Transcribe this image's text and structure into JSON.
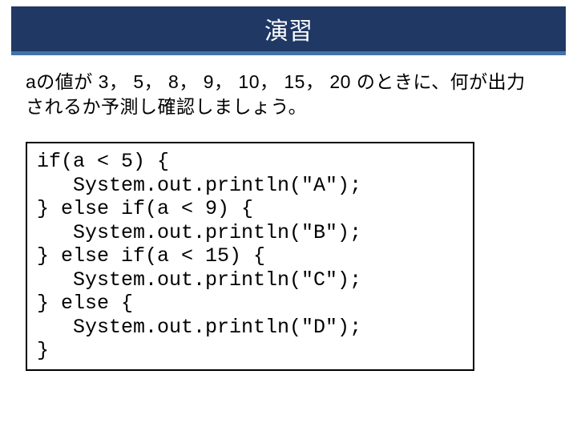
{
  "title": "演習",
  "instruction_line1": "aの値が 3， 5， 8， 9， 10， 15， 20 のときに、何が出力",
  "instruction_line2": "されるか予測し確認しましょう。",
  "code": {
    "l1": "if(a < 5) {",
    "l2": "   System.out.println(\"A\");",
    "l3": "} else if(a < 9) {",
    "l4": "   System.out.println(\"B\");",
    "l5": "} else if(a < 15) {",
    "l6": "   System.out.println(\"C\");",
    "l7": "} else {",
    "l8": "   System.out.println(\"D\");",
    "l9": "}"
  }
}
